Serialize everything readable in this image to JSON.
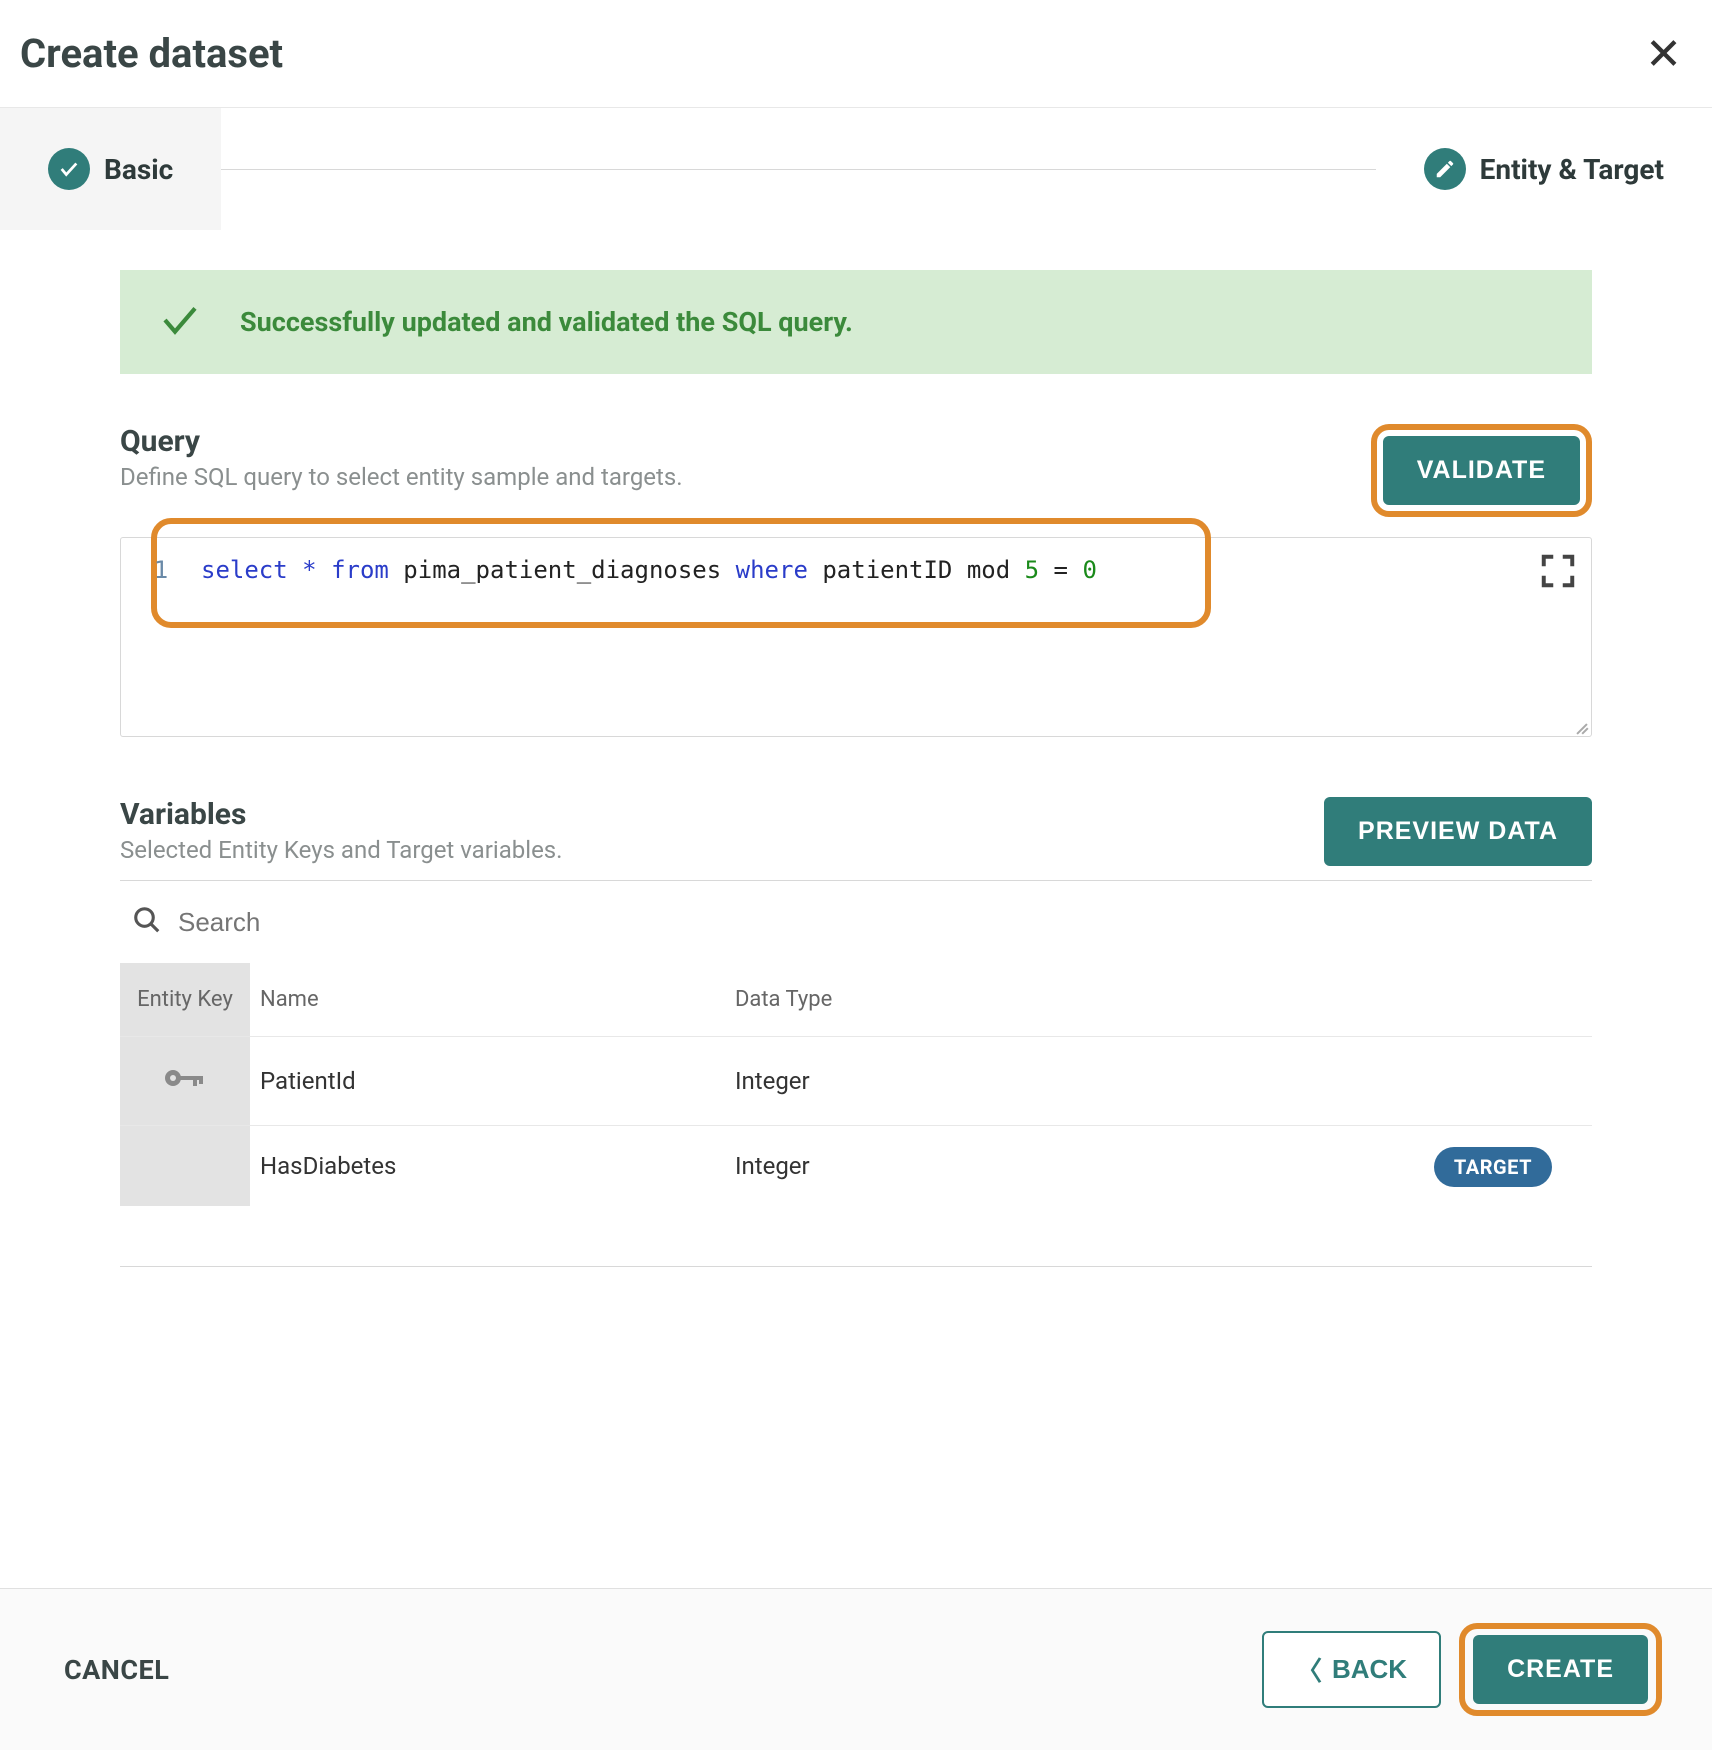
{
  "header": {
    "title": "Create dataset"
  },
  "steps": {
    "basic": "Basic",
    "entity_target": "Entity & Target"
  },
  "banner": {
    "message": "Successfully updated and validated the SQL query."
  },
  "query": {
    "title": "Query",
    "subtitle": "Define SQL query to select entity sample and targets.",
    "validate_label": "VALIDATE",
    "line_number": "1",
    "sql": {
      "kw_select": "select",
      "star": " * ",
      "kw_from": "from",
      "table": " pima_patient_diagnoses ",
      "kw_where": "where",
      "expr": " patientID mod ",
      "num1": "5",
      "eq": " = ",
      "num2": "0"
    }
  },
  "variables": {
    "title": "Variables",
    "subtitle": "Selected Entity Keys and Target variables.",
    "preview_label": "PREVIEW DATA",
    "search_placeholder": "Search",
    "headers": {
      "entity_key": "Entity Key",
      "name": "Name",
      "data_type": "Data Type"
    },
    "rows": [
      {
        "name": "PatientId",
        "data_type": "Integer",
        "is_key": true,
        "is_target": false
      },
      {
        "name": "HasDiabetes",
        "data_type": "Integer",
        "is_key": false,
        "is_target": true
      }
    ],
    "target_badge": "TARGET"
  },
  "footer": {
    "cancel": "CANCEL",
    "back": "BACK",
    "create": "CREATE"
  }
}
